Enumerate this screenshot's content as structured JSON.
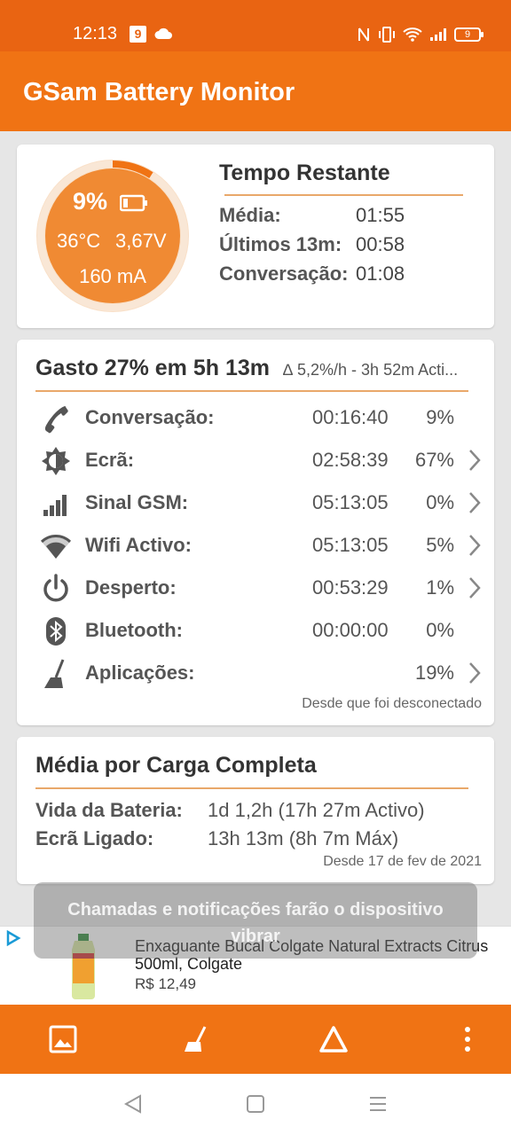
{
  "status_bar": {
    "time": "12:13",
    "badge": "9",
    "battery": "9"
  },
  "app": {
    "title": "GSam Battery Monitor"
  },
  "gauge": {
    "percent": "9%",
    "temperature": "36°C",
    "voltage": "3,67V",
    "current": "160 mA",
    "level": 0.09
  },
  "tempo": {
    "title": "Tempo Restante",
    "rows": [
      {
        "label": "Média:",
        "value": "01:55"
      },
      {
        "label": "Últimos 13m:",
        "value": "00:58"
      },
      {
        "label": "Conversação:",
        "value": "01:08"
      }
    ]
  },
  "usage": {
    "title": "Gasto 27% em 5h 13m",
    "subtitle": "∆ 5,2%/h - 3h 52m Acti...",
    "rows": [
      {
        "label": "Conversação:",
        "time": "00:16:40",
        "percent": "9%",
        "icon": "phone-icon"
      },
      {
        "label": "Ecrã:",
        "time": "02:58:39",
        "percent": "67%",
        "icon": "brightness-icon"
      },
      {
        "label": "Sinal GSM:",
        "time": "05:13:05",
        "percent": "0%",
        "icon": "signal-icon"
      },
      {
        "label": "Wifi Activo:",
        "time": "05:13:05",
        "percent": "5%",
        "icon": "wifi-icon"
      },
      {
        "label": "Desperto:",
        "time": "00:53:29",
        "percent": "1%",
        "icon": "power-icon"
      },
      {
        "label": "Bluetooth:",
        "time": "00:00:00",
        "percent": "0%",
        "icon": "bluetooth-icon"
      },
      {
        "label": "Aplicações:",
        "time": "",
        "percent": "19%",
        "icon": "broom-icon"
      }
    ],
    "footer": "Desde que foi desconectado"
  },
  "media": {
    "title": "Média por Carga Completa",
    "rows": [
      {
        "label": "Vida da Bateria:",
        "value": "1d 1,2h (17h 27m Activo)"
      },
      {
        "label": "Ecrã Ligado:",
        "value": "13h 13m (8h 7m Máx)"
      }
    ],
    "footer": "Desde 17 de fev de 2021"
  },
  "toast": {
    "text": "Chamadas e notificações farão o dispositivo vibrar"
  },
  "ad": {
    "title": "Enxaguante Bucal Colgate Natural Extracts Citrus 500ml, Colgate",
    "price": "R$ 12,49"
  },
  "colors": {
    "primary": "#f07314",
    "status_bar": "#e96412",
    "gauge_fill": "#f08a33",
    "divider": "#e9a86a"
  }
}
